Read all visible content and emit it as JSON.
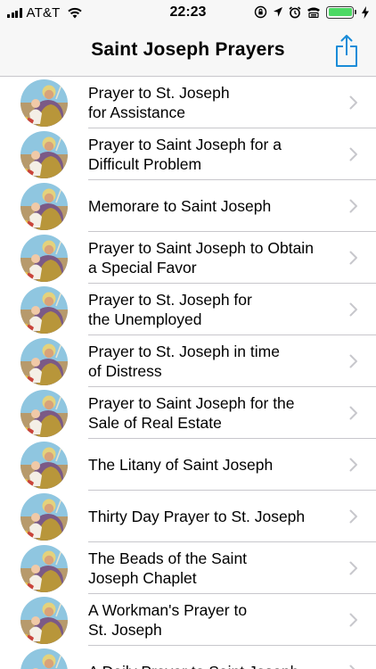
{
  "status_bar": {
    "carrier": "AT&T",
    "time": "22:23",
    "battery_level": 1.0,
    "battery_color": "#4cd964"
  },
  "nav": {
    "title": "Saint Joseph Prayers",
    "share_icon": "share-icon",
    "accent_color": "#1a8cd8"
  },
  "prayers": [
    {
      "label": "Prayer to St. Joseph\nfor Assistance"
    },
    {
      "label": "Prayer to Saint Joseph for a\nDifficult Problem"
    },
    {
      "label": "Memorare to Saint Joseph"
    },
    {
      "label": "Prayer to Saint Joseph to Obtain\na Special Favor"
    },
    {
      "label": "Prayer to St. Joseph for\nthe Unemployed"
    },
    {
      "label": "Prayer to St. Joseph in time\nof Distress"
    },
    {
      "label": "Prayer to Saint Joseph for the\nSale of Real Estate"
    },
    {
      "label": "The Litany of Saint Joseph"
    },
    {
      "label": "Thirty Day Prayer to St. Joseph"
    },
    {
      "label": "The Beads of the Saint\nJoseph Chaplet"
    },
    {
      "label": "A Workman's Prayer to\nSt. Joseph"
    },
    {
      "label": "A Daily Prayer to Saint Joseph"
    }
  ]
}
